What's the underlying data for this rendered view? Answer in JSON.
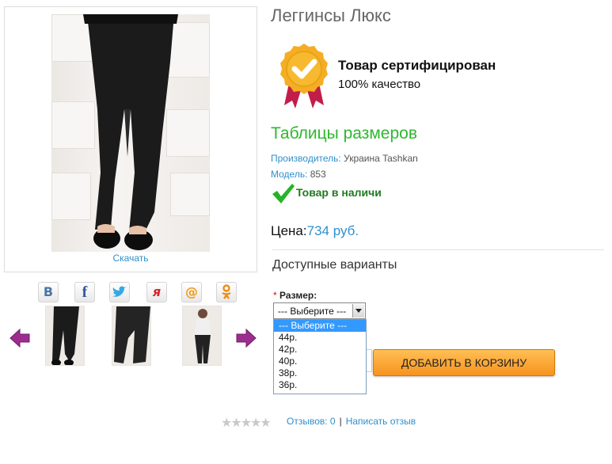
{
  "product": {
    "title": "Леггинсы Люкс",
    "download_label": "Скачать",
    "certificate": {
      "title": "Товар сертифицирован",
      "subtitle": "100% качество"
    },
    "size_chart_link": "Таблицы размеров",
    "manufacturer": {
      "label": "Производитель:",
      "value": "Украина Tashkan"
    },
    "model": {
      "label": "Модель:",
      "value": "853"
    },
    "stock_status": "Товар в наличи",
    "price": {
      "label": "Цена:",
      "value": "734 руб."
    }
  },
  "social": [
    {
      "name": "vk",
      "glyph": "B",
      "color": "#4a76a8"
    },
    {
      "name": "facebook",
      "glyph": "f",
      "color": "#3b5998"
    },
    {
      "name": "twitter",
      "glyph": "🐦",
      "color": "#33a9e6"
    },
    {
      "name": "yaru",
      "glyph": "я",
      "color": "#d6262a"
    },
    {
      "name": "mailru",
      "glyph": "@",
      "color": "#f09a1a"
    },
    {
      "name": "odnoklassniki",
      "glyph": "ок",
      "color": "#f08b15"
    }
  ],
  "options": {
    "title": "Доступные варианты",
    "size": {
      "required_mark": "*",
      "label": "Размер:",
      "selected": "--- Выберите ---",
      "items": [
        "--- Выберите ---",
        "44р.",
        "42р.",
        "40р.",
        "38р.",
        "36р."
      ]
    }
  },
  "cart": {
    "button_label": "ДОБАВИТЬ В КОРЗИНУ"
  },
  "reviews": {
    "label": "Отзывов: 0",
    "separator": "|",
    "write_label": "Написать отзыв",
    "rating": 0,
    "max_rating": 5
  },
  "colors": {
    "link": "#2f8fcc",
    "green": "#2eb82e",
    "button": "#f7931e"
  }
}
